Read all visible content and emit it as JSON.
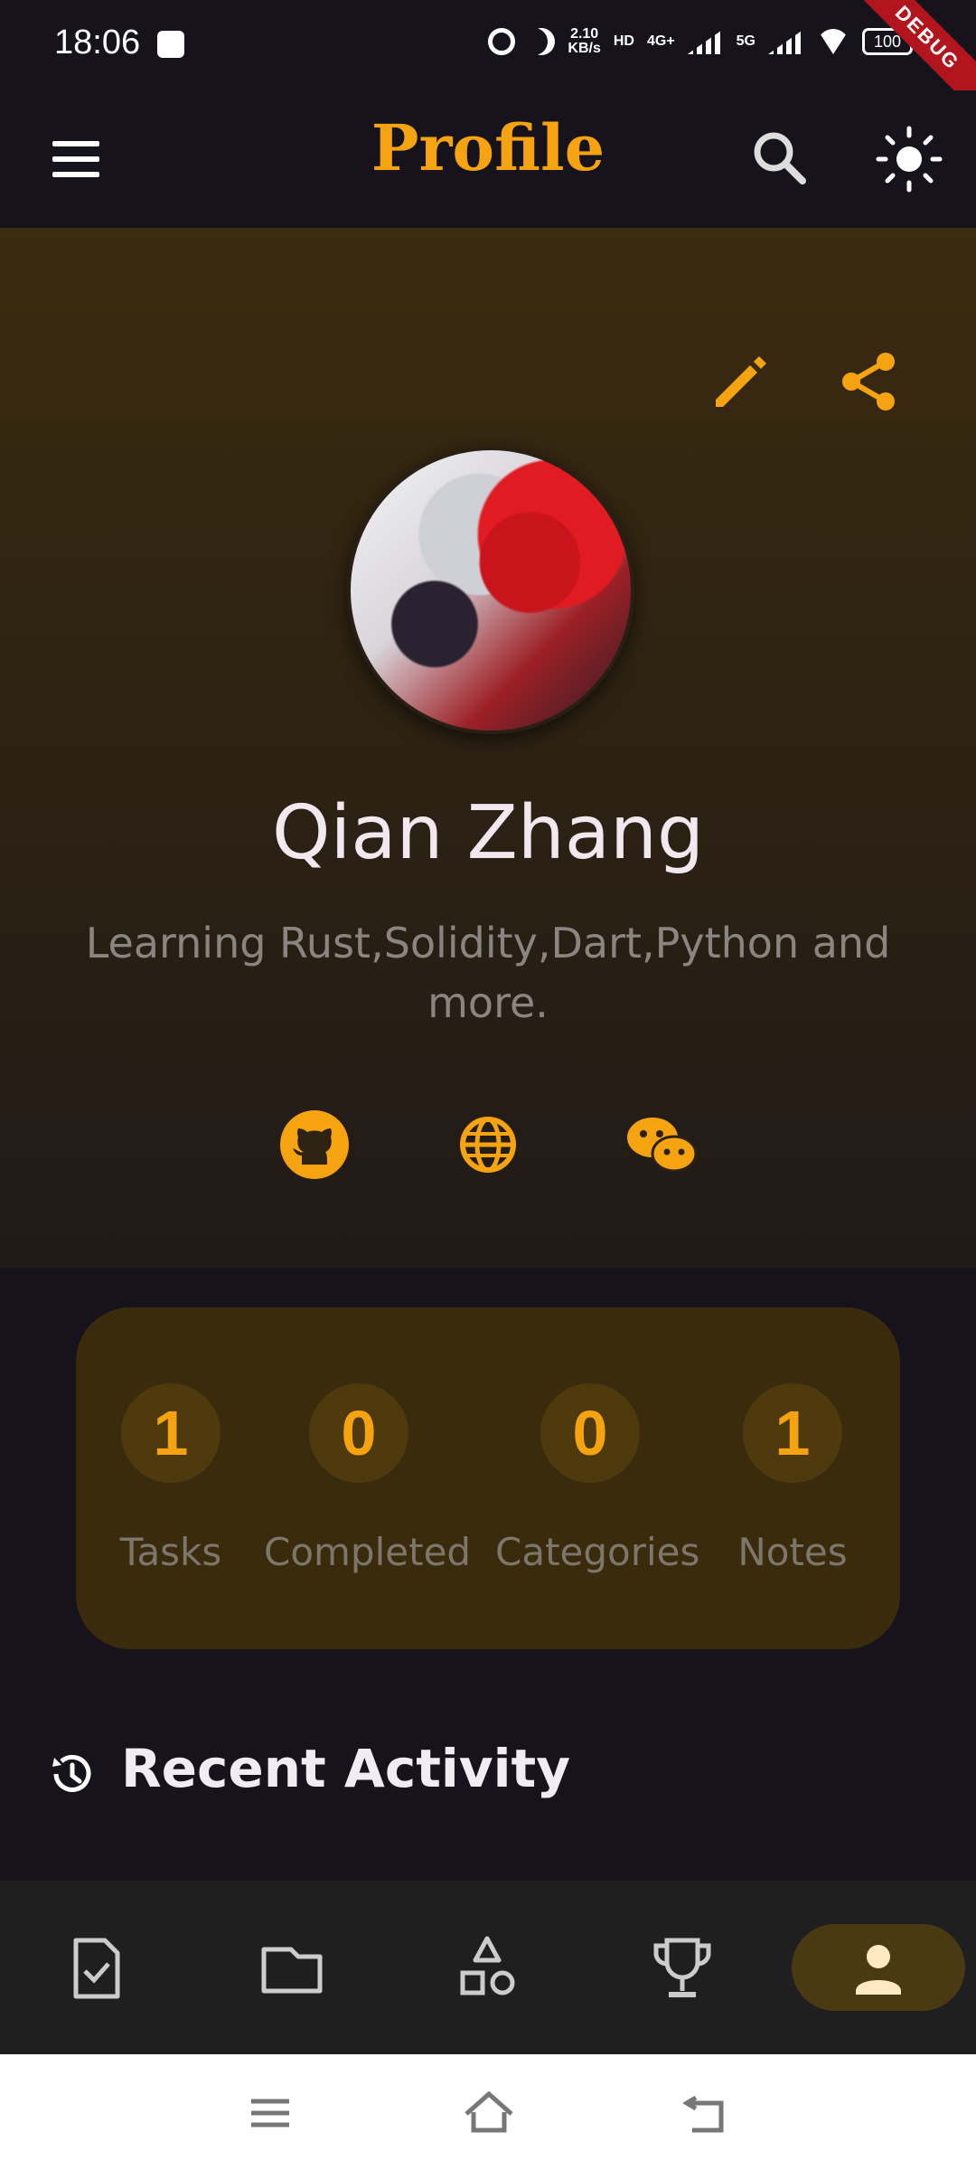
{
  "status_bar": {
    "time": "18:06",
    "speed_value": "2.10",
    "speed_unit": "KB/s",
    "network_hd": "HD",
    "network_4g": "4G+",
    "network_5g": "5G",
    "battery": "100",
    "debug_ribbon": "DEBUG"
  },
  "app_bar": {
    "title": "Profile",
    "menu_icon": "hamburger-menu-icon",
    "search_icon": "search-icon",
    "theme_icon": "sun-icon"
  },
  "profile": {
    "name": "Qian Zhang",
    "bio": "Learning Rust,Solidity,Dart,Python and more.",
    "edit_icon": "pencil-icon",
    "share_icon": "share-icon",
    "social_links": [
      "github-icon",
      "globe-icon",
      "wechat-icon"
    ]
  },
  "stats": [
    {
      "value": "1",
      "label": "Tasks"
    },
    {
      "value": "0",
      "label": "Completed"
    },
    {
      "value": "0",
      "label": "Categories"
    },
    {
      "value": "1",
      "label": "Notes"
    }
  ],
  "recent_activity": {
    "title": "Recent Activity",
    "icon": "history-icon"
  },
  "bottom_nav": {
    "items": [
      "task-checklist-icon",
      "folder-icon",
      "shapes-icon",
      "trophy-icon",
      "person-icon"
    ],
    "active": "person-icon"
  },
  "colors": {
    "accent": "#f6a311",
    "background": "#16131c",
    "stats_card": "#392b0c"
  }
}
